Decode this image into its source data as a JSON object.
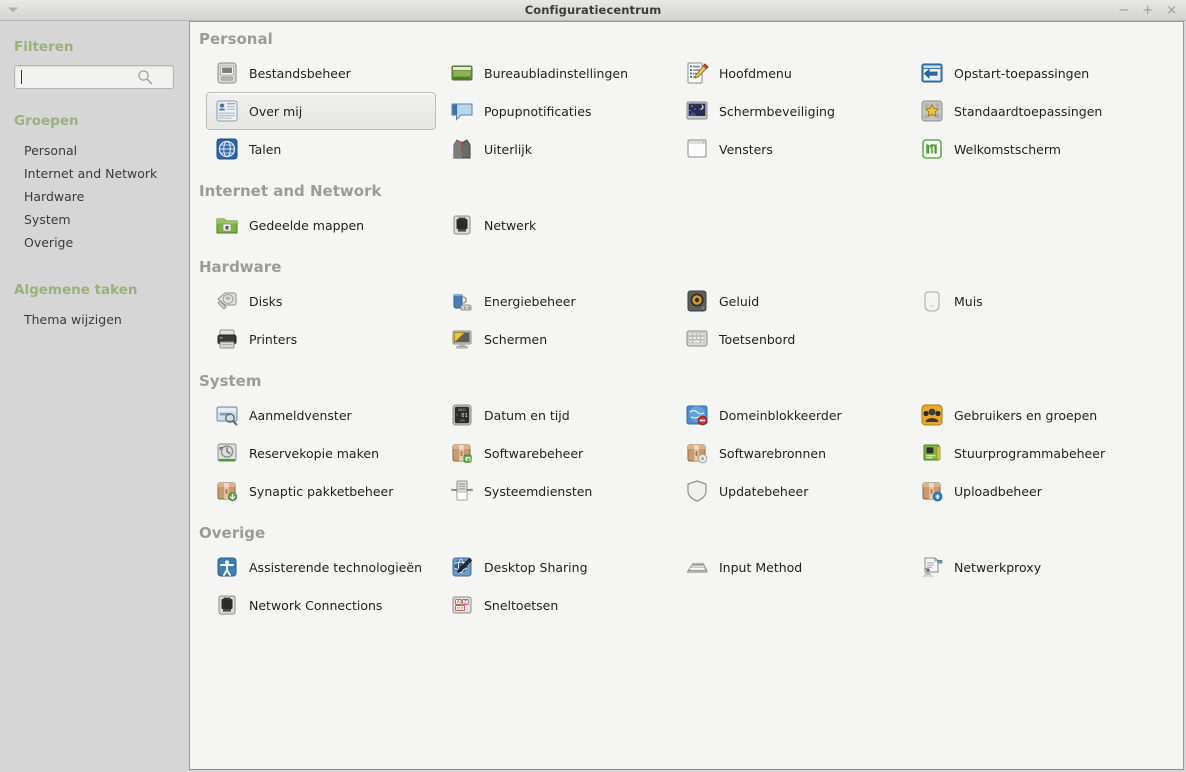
{
  "window": {
    "title": "Configuratiecentrum",
    "menu_arrow_icon": "chevron-down-icon",
    "minimize_label": "−",
    "maximize_label": "+",
    "close_label": "×"
  },
  "sidebar": {
    "filter_heading": "Filteren",
    "search": {
      "value": "",
      "placeholder": ""
    },
    "search_icon": "search-icon",
    "groups_heading": "Groepen",
    "groups": [
      {
        "label": "Personal"
      },
      {
        "label": "Internet and Network"
      },
      {
        "label": "Hardware"
      },
      {
        "label": "System"
      },
      {
        "label": "Overige"
      }
    ],
    "tasks_heading": "Algemene taken",
    "tasks": [
      {
        "label": "Thema wijzigen"
      }
    ]
  },
  "colors": {
    "sidebar_bg": "#d6d6d6",
    "panel_bg": "#f5f5f3",
    "heading_green": "#9cb07c",
    "section_gray": "#9b9b9b",
    "titlebar_text": "#3c3c3c"
  },
  "sections": [
    {
      "title": "Personal",
      "items": [
        {
          "label": "Bestandsbeheer",
          "icon": "file-manager-icon",
          "selected": false
        },
        {
          "label": "Bureaubladinstellingen",
          "icon": "desktop-settings-icon",
          "selected": false
        },
        {
          "label": "Hoofdmenu",
          "icon": "main-menu-icon",
          "selected": false
        },
        {
          "label": "Opstart-toepassingen",
          "icon": "startup-applications-icon",
          "selected": false
        },
        {
          "label": "Over mij",
          "icon": "about-me-icon",
          "selected": true
        },
        {
          "label": "Popupnotificaties",
          "icon": "notifications-icon",
          "selected": false
        },
        {
          "label": "Schermbeveiliging",
          "icon": "screensaver-icon",
          "selected": false
        },
        {
          "label": "Standaardtoepassingen",
          "icon": "default-applications-icon",
          "selected": false
        },
        {
          "label": "Talen",
          "icon": "languages-icon",
          "selected": false
        },
        {
          "label": "Uiterlijk",
          "icon": "appearance-icon",
          "selected": false
        },
        {
          "label": "Vensters",
          "icon": "windows-icon",
          "selected": false
        },
        {
          "label": "Welkomstscherm",
          "icon": "welcome-screen-icon",
          "selected": false
        }
      ]
    },
    {
      "title": "Internet and Network",
      "items": [
        {
          "label": "Gedeelde mappen",
          "icon": "shared-folders-icon",
          "selected": false
        },
        {
          "label": "Netwerk",
          "icon": "network-icon",
          "selected": false
        }
      ]
    },
    {
      "title": "Hardware",
      "items": [
        {
          "label": "Disks",
          "icon": "disks-icon",
          "selected": false
        },
        {
          "label": "Energiebeheer",
          "icon": "power-manager-icon",
          "selected": false
        },
        {
          "label": "Geluid",
          "icon": "sound-icon",
          "selected": false
        },
        {
          "label": "Muis",
          "icon": "mouse-icon",
          "selected": false
        },
        {
          "label": "Printers",
          "icon": "printers-icon",
          "selected": false
        },
        {
          "label": "Schermen",
          "icon": "displays-icon",
          "selected": false
        },
        {
          "label": "Toetsenbord",
          "icon": "keyboard-icon",
          "selected": false
        }
      ]
    },
    {
      "title": "System",
      "items": [
        {
          "label": "Aanmeldvenster",
          "icon": "login-window-icon",
          "selected": false
        },
        {
          "label": "Datum en tijd",
          "icon": "date-time-icon",
          "selected": false
        },
        {
          "label": "Domeinblokkeerder",
          "icon": "domain-blocker-icon",
          "selected": false
        },
        {
          "label": "Gebruikers en groepen",
          "icon": "users-groups-icon",
          "selected": false
        },
        {
          "label": "Reservekopie maken",
          "icon": "backup-icon",
          "selected": false
        },
        {
          "label": "Softwarebeheer",
          "icon": "software-manager-icon",
          "selected": false
        },
        {
          "label": "Softwarebronnen",
          "icon": "software-sources-icon",
          "selected": false
        },
        {
          "label": "Stuurprogrammabeheer",
          "icon": "driver-manager-icon",
          "selected": false
        },
        {
          "label": "Synaptic pakketbeheer",
          "icon": "synaptic-icon",
          "selected": false
        },
        {
          "label": "Systeemdiensten",
          "icon": "system-services-icon",
          "selected": false
        },
        {
          "label": "Updatebeheer",
          "icon": "update-manager-icon",
          "selected": false
        },
        {
          "label": "Uploadbeheer",
          "icon": "upload-manager-icon",
          "selected": false
        }
      ]
    },
    {
      "title": "Overige",
      "items": [
        {
          "label": "Assisterende technologieën",
          "icon": "accessibility-icon",
          "selected": false
        },
        {
          "label": "Desktop Sharing",
          "icon": "desktop-sharing-icon",
          "selected": false
        },
        {
          "label": "Input Method",
          "icon": "input-method-icon",
          "selected": false
        },
        {
          "label": "Netwerkproxy",
          "icon": "network-proxy-icon",
          "selected": false
        },
        {
          "label": "Network Connections",
          "icon": "network-connections-icon",
          "selected": false
        },
        {
          "label": "Sneltoetsen",
          "icon": "shortcuts-icon",
          "selected": false
        }
      ]
    }
  ]
}
